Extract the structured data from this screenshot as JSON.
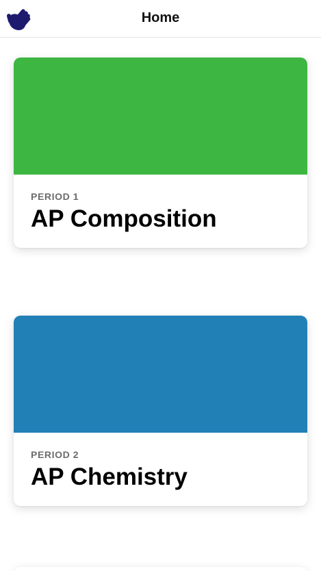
{
  "header": {
    "title": "Home",
    "logo_icon": "raised-hand-icon",
    "logo_color": "#1e1a6e"
  },
  "classes": [
    {
      "period": "PERIOD 1",
      "name": "AP Composition",
      "color": "#3db642"
    },
    {
      "period": "PERIOD 2",
      "name": "AP Chemistry",
      "color": "#2180b5"
    }
  ]
}
